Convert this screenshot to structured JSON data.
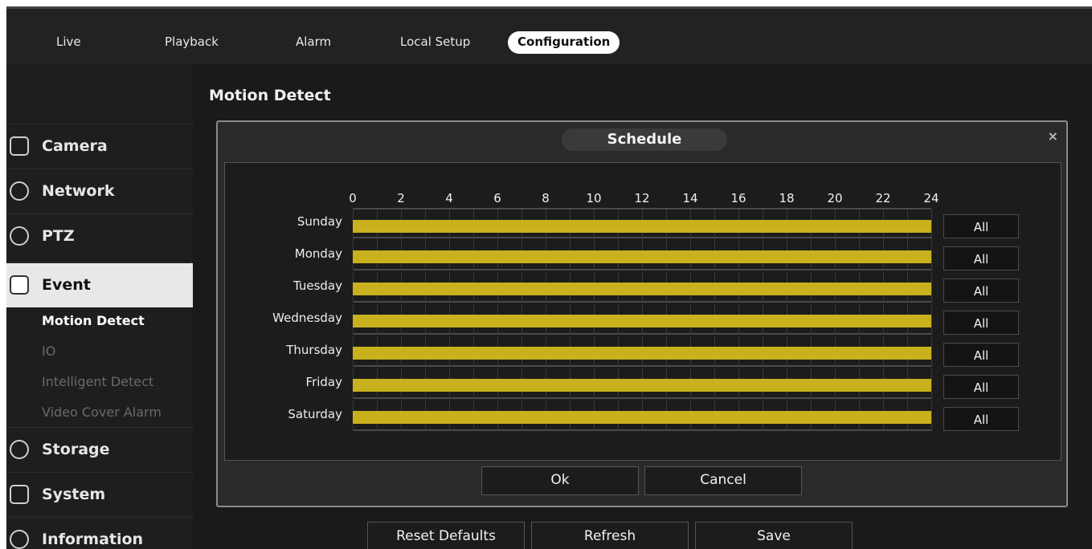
{
  "topnav": {
    "tabs": [
      {
        "label": "Live"
      },
      {
        "label": "Playback"
      },
      {
        "label": "Alarm"
      },
      {
        "label": "Local Setup"
      },
      {
        "label": "Configuration",
        "active": true
      }
    ]
  },
  "sidebar": {
    "items": [
      {
        "label": "Camera",
        "icon": "camera-icon"
      },
      {
        "label": "Network",
        "icon": "network-icon"
      },
      {
        "label": "PTZ",
        "icon": "ptz-icon"
      },
      {
        "label": "Event",
        "icon": "event-icon",
        "active": true
      },
      {
        "label": "Storage",
        "icon": "storage-icon"
      },
      {
        "label": "System",
        "icon": "system-icon"
      },
      {
        "label": "Information",
        "icon": "information-icon"
      }
    ],
    "event_subitems": [
      {
        "label": "Motion Detect",
        "current": true
      },
      {
        "label": "IO"
      },
      {
        "label": "Intelligent Detect"
      },
      {
        "label": "Video Cover Alarm"
      }
    ]
  },
  "content": {
    "page_title": "Motion Detect"
  },
  "schedule_dialog": {
    "title": "Schedule",
    "close_label": "×",
    "hours": [
      "0",
      "2",
      "4",
      "6",
      "8",
      "10",
      "12",
      "14",
      "16",
      "18",
      "20",
      "22",
      "24"
    ],
    "days": [
      {
        "label": "Sunday",
        "all_label": "All",
        "start": 0,
        "end": 24
      },
      {
        "label": "Monday",
        "all_label": "All",
        "start": 0,
        "end": 24
      },
      {
        "label": "Tuesday",
        "all_label": "All",
        "start": 0,
        "end": 24
      },
      {
        "label": "Wednesday",
        "all_label": "All",
        "start": 0,
        "end": 24
      },
      {
        "label": "Thursday",
        "all_label": "All",
        "start": 0,
        "end": 24
      },
      {
        "label": "Friday",
        "all_label": "All",
        "start": 0,
        "end": 24
      },
      {
        "label": "Saturday",
        "all_label": "All",
        "start": 0,
        "end": 24
      }
    ],
    "bar_color": "#c9b11e",
    "ok_label": "Ok",
    "cancel_label": "Cancel"
  },
  "footer": {
    "reset_label": "Reset Defaults",
    "refresh_label": "Refresh",
    "save_label": "Save"
  }
}
